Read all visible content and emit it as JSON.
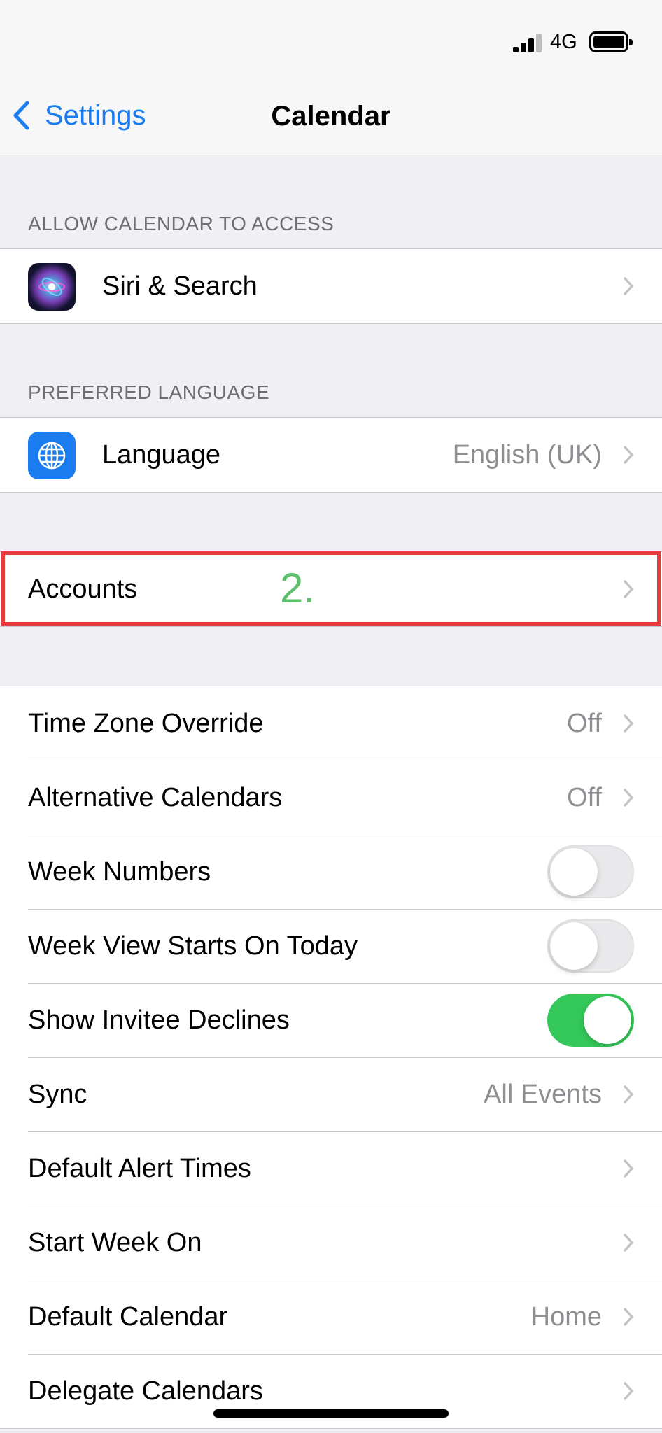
{
  "status_bar": {
    "network": "4G",
    "signal_icon": "cellular-signal-icon",
    "battery_icon": "battery-icon"
  },
  "nav": {
    "back_label": "Settings",
    "title": "Calendar"
  },
  "sections": {
    "access_header": "ALLOW CALENDAR TO ACCESS",
    "language_header": "PREFERRED LANGUAGE"
  },
  "rows": {
    "siri": {
      "label": "Siri & Search"
    },
    "language": {
      "label": "Language",
      "value": "English (UK)"
    },
    "accounts": {
      "label": "Accounts"
    },
    "time_zone": {
      "label": "Time Zone Override",
      "value": "Off"
    },
    "alt_calendars": {
      "label": "Alternative Calendars",
      "value": "Off"
    },
    "week_numbers": {
      "label": "Week Numbers",
      "toggle": "off"
    },
    "week_view": {
      "label": "Week View Starts On Today",
      "toggle": "off"
    },
    "invitee_declines": {
      "label": "Show Invitee Declines",
      "toggle": "on"
    },
    "sync": {
      "label": "Sync",
      "value": "All Events"
    },
    "alert_times": {
      "label": "Default Alert Times"
    },
    "start_week": {
      "label": "Start Week On"
    },
    "default_calendar": {
      "label": "Default Calendar",
      "value": "Home"
    },
    "delegate": {
      "label": "Delegate Calendars"
    }
  },
  "annotation": {
    "step_label": "2.",
    "highlight_color": "#e83b3b",
    "label_color": "#5fbf6f"
  },
  "colors": {
    "accent": "#1b7cf0",
    "toggle_on": "#34c759"
  }
}
